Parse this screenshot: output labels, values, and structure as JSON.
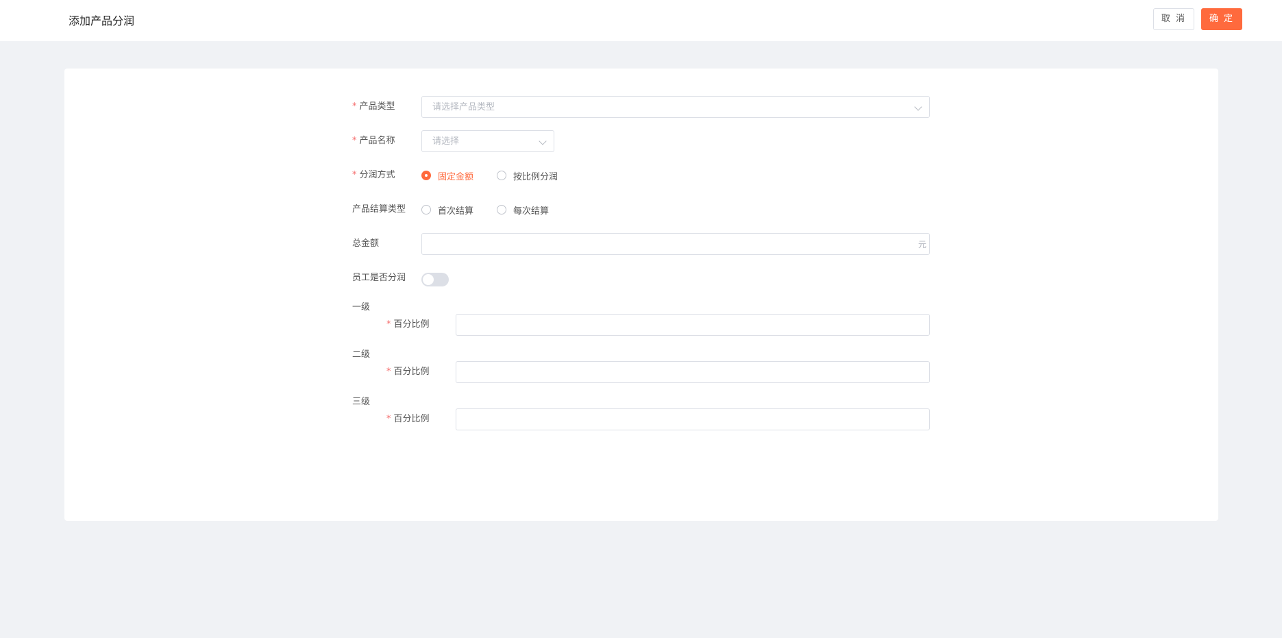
{
  "header": {
    "title": "添加产品分润",
    "cancel_label": "取 消",
    "confirm_label": "确 定"
  },
  "form": {
    "required_mark": "*",
    "product_type": {
      "label": "产品类型",
      "placeholder": "请选择产品类型"
    },
    "product_name": {
      "label": "产品名称",
      "placeholder": "请选择"
    },
    "share_method": {
      "label": "分润方式",
      "options": [
        "固定金额",
        "按比例分润"
      ],
      "selected": "固定金额"
    },
    "settlement_type": {
      "label": "产品结算类型",
      "options": [
        "首次结算",
        "每次结算"
      ],
      "selected": ""
    },
    "total_amount": {
      "label": "总金额",
      "value": "",
      "suffix": "元"
    },
    "employee_share": {
      "label": "员工是否分润",
      "enabled": false
    },
    "levels": [
      {
        "title": "一级",
        "field_label": "百分比例",
        "value": ""
      },
      {
        "title": "二级",
        "field_label": "百分比例",
        "value": ""
      },
      {
        "title": "三级",
        "field_label": "百分比例",
        "value": ""
      }
    ]
  },
  "colors": {
    "accent": "#ff6a3d",
    "required": "#f56c6c",
    "background": "#f0f2f5"
  }
}
